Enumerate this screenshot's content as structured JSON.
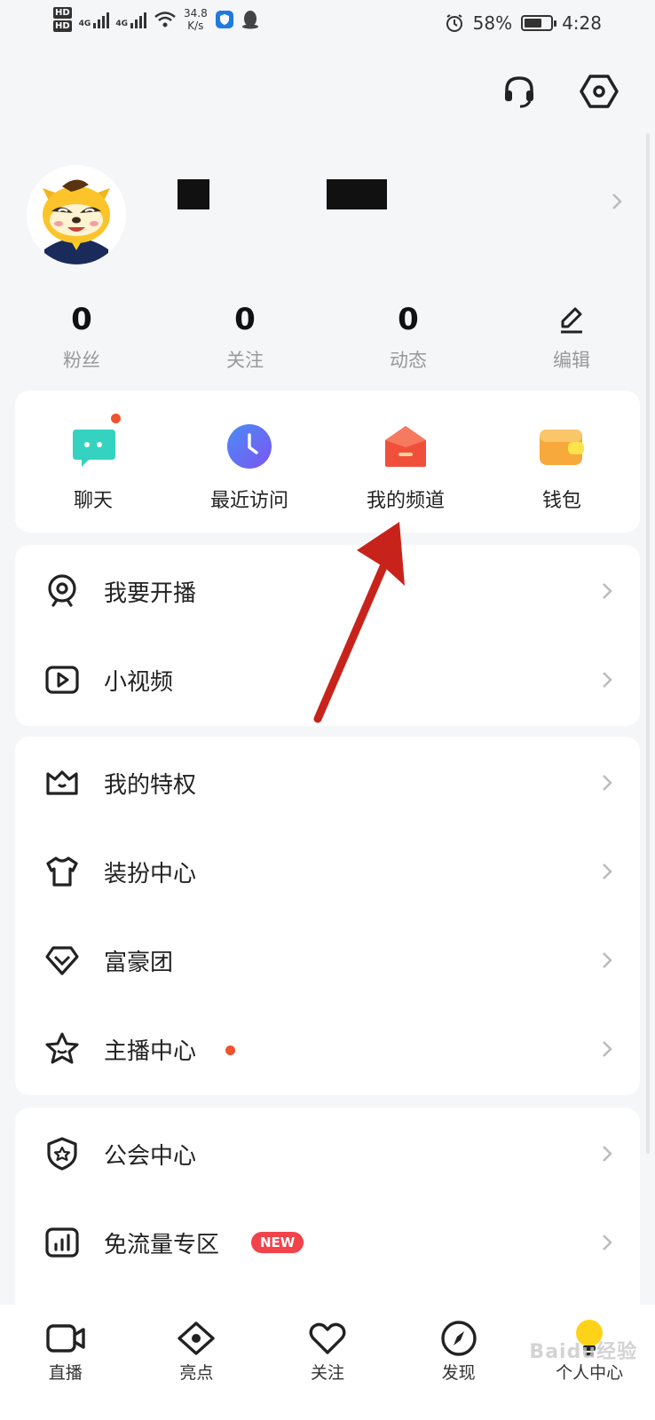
{
  "status_bar": {
    "hd_top": "HD",
    "hd_bottom": "HD",
    "net1": "4G",
    "net2": "4G",
    "speed_value": "34.8",
    "speed_unit": "K/s",
    "battery": "58%",
    "time": "4:28"
  },
  "header": {
    "support_icon": "headset-icon",
    "settings_icon": "hexagon-settings-icon"
  },
  "stats": [
    {
      "value": "0",
      "label": "粉丝"
    },
    {
      "value": "0",
      "label": "关注"
    },
    {
      "value": "0",
      "label": "动态"
    }
  ],
  "edit": {
    "label": "编辑"
  },
  "quick_actions": [
    {
      "label": "聊天",
      "icon": "chat-icon",
      "color": "#35d2c0"
    },
    {
      "label": "最近访问",
      "icon": "clock-icon",
      "color": "#5b6cf5"
    },
    {
      "label": "我的频道",
      "icon": "channel-house-icon",
      "color": "#f0503a"
    },
    {
      "label": "钱包",
      "icon": "wallet-icon",
      "color": "#f7a93b"
    }
  ],
  "menu_group_1": [
    {
      "label": "我要开播",
      "icon": "webcam-icon"
    },
    {
      "label": "小视频",
      "icon": "video-play-icon"
    }
  ],
  "menu_group_2": [
    {
      "label": "我的特权",
      "icon": "crown-icon"
    },
    {
      "label": "装扮中心",
      "icon": "tshirt-icon"
    },
    {
      "label": "富豪团",
      "icon": "diamond-icon"
    },
    {
      "label": "主播中心",
      "icon": "star-icon"
    }
  ],
  "menu_group_3": [
    {
      "label": "公会中心",
      "icon": "shield-star-icon"
    },
    {
      "label": "免流量专区",
      "icon": "bar-chart-icon",
      "badge": "NEW"
    }
  ],
  "tabs": [
    {
      "label": "直播",
      "icon": "video-camera-icon"
    },
    {
      "label": "亮点",
      "icon": "eye-icon"
    },
    {
      "label": "关注",
      "icon": "heart-icon"
    },
    {
      "label": "发现",
      "icon": "compass-icon"
    },
    {
      "label": "个人中心",
      "icon": "lightbulb-icon"
    }
  ],
  "watermark": "Baidu经验",
  "colors": {
    "accent_red": "#f0522e",
    "arrow_red": "#c8231b",
    "active_tab": "#ffd21a"
  }
}
